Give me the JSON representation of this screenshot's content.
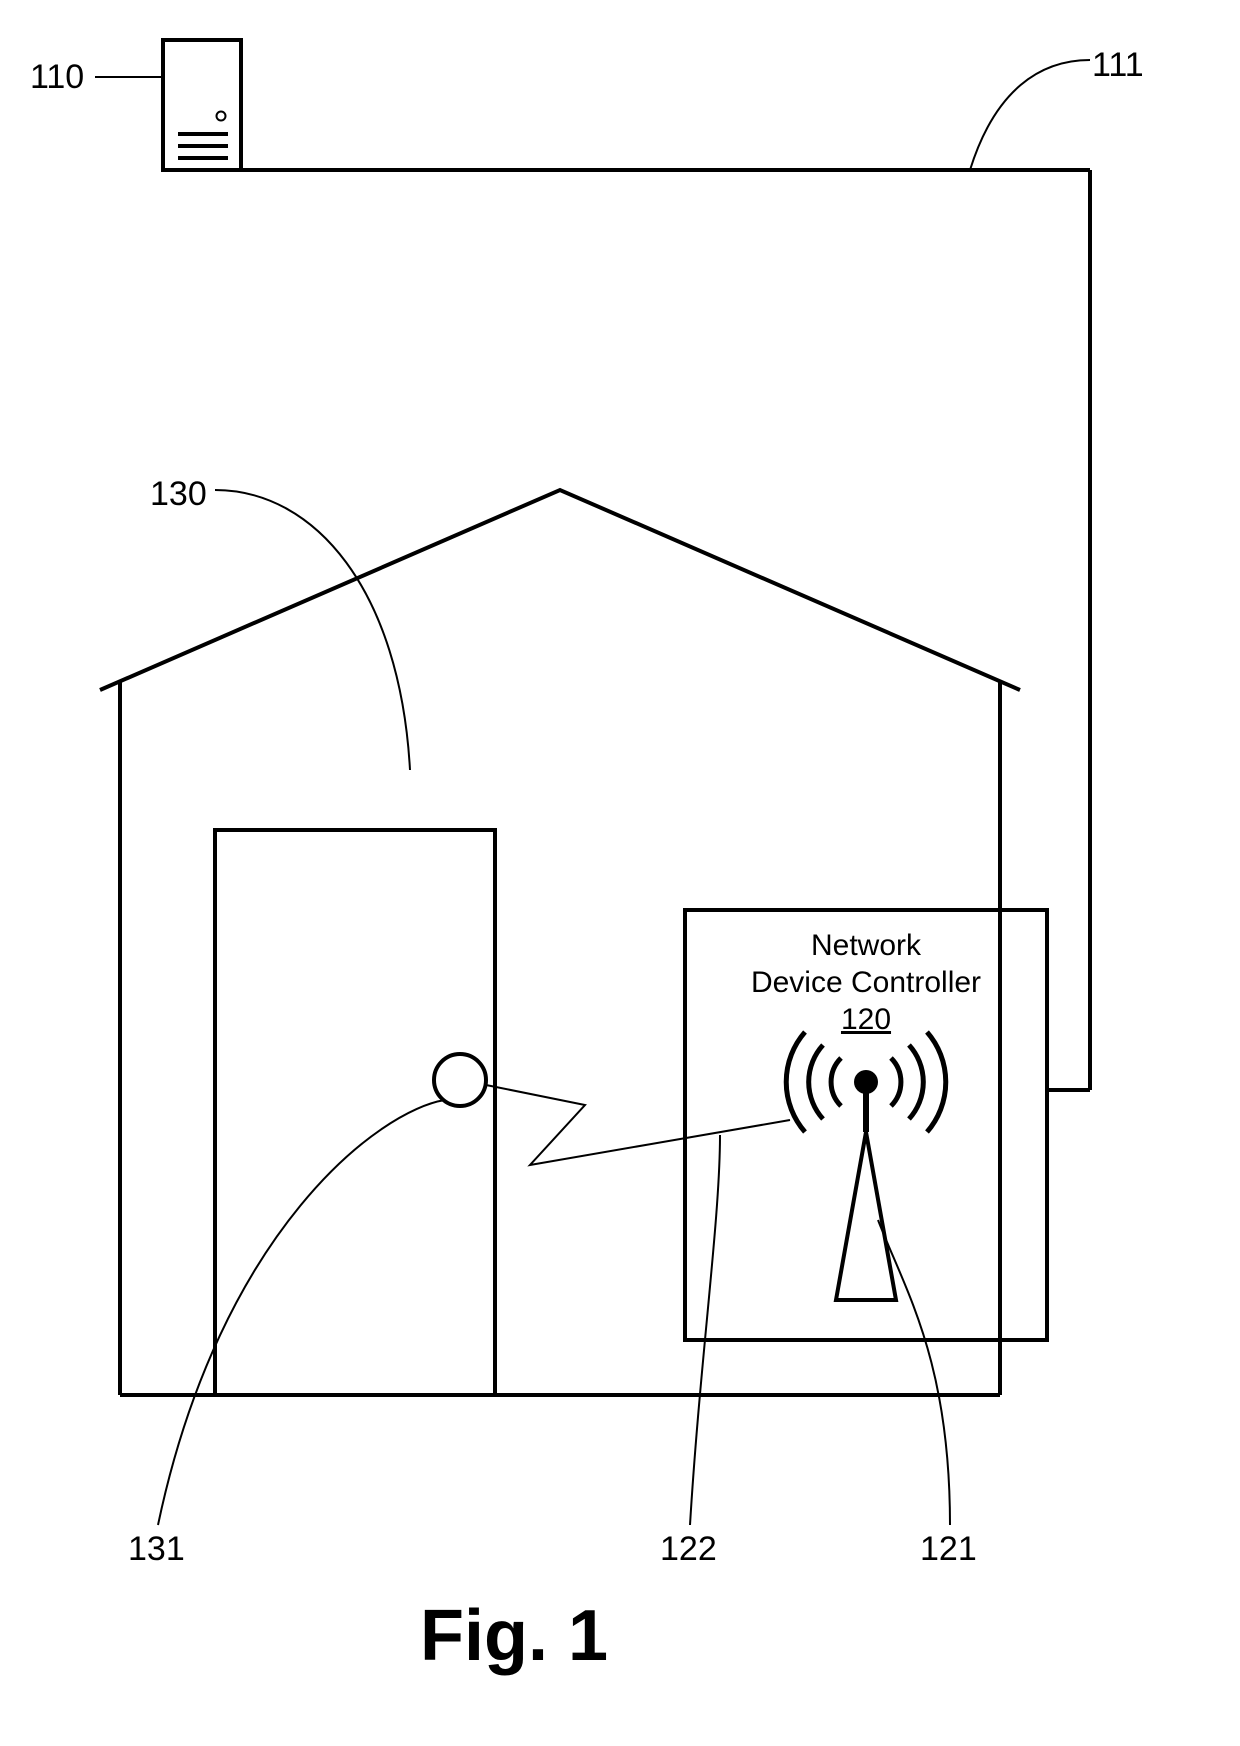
{
  "labels": {
    "l110": "110",
    "l111": "111",
    "l130": "130",
    "l131": "131",
    "l122": "122",
    "l121": "121"
  },
  "controller": {
    "line1": "Network",
    "line2": "Device Controller",
    "number": "120"
  },
  "figure_caption": "Fig. 1"
}
